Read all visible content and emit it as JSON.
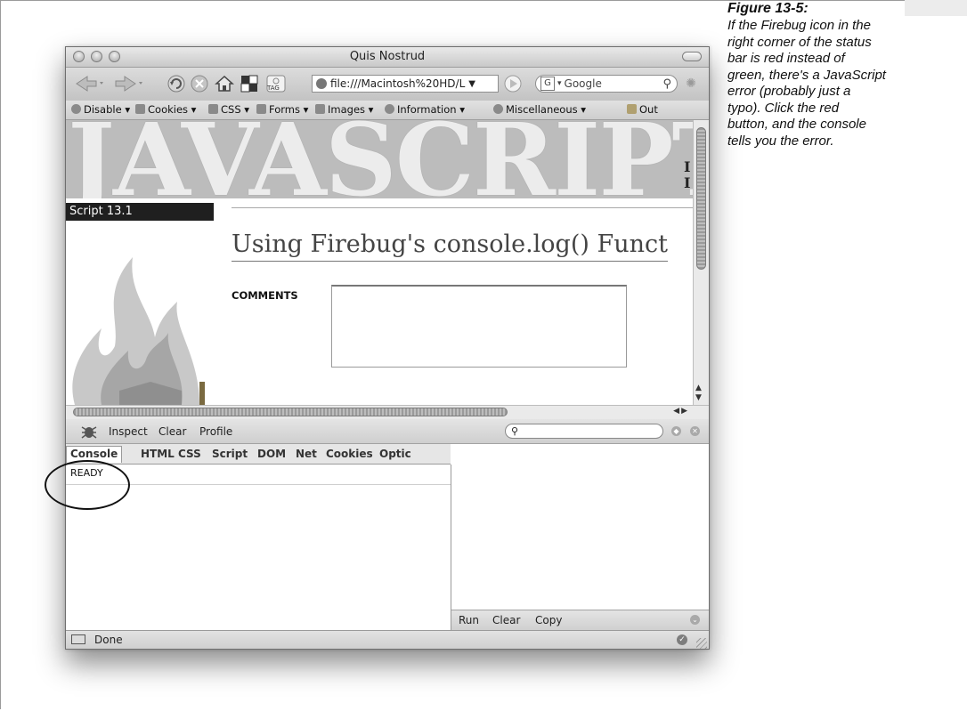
{
  "caption": {
    "figure_label": "Figure 13-5:",
    "lines": [
      "If the Firebug icon in the",
      "right corner of the status",
      "bar is red instead of",
      "green, there's a JavaScript",
      "error (probably just a",
      "typo). Click the red",
      "button, and the console",
      "tells you the error."
    ]
  },
  "window": {
    "title": "Quis Nostrud",
    "url": "file:///Macintosh%20HD/L",
    "search_placeholder": "Google",
    "tag_label": "TAG"
  },
  "dev_toolbar": {
    "items": [
      "Disable",
      "Cookies",
      "CSS",
      "Forms",
      "Images",
      "Information",
      "Miscellaneous",
      "Out"
    ]
  },
  "page": {
    "banner_text": "JAVASCRIPT",
    "banner_side": [
      "I",
      "I"
    ],
    "script_label": "Script 13.1",
    "heading": "Using Firebug's console.log() Funct",
    "comments_label": "COMMENTS"
  },
  "firebug": {
    "toolbar": [
      "Inspect",
      "Clear",
      "Profile"
    ],
    "tabs": [
      "Console",
      "HTML",
      "CSS",
      "Script",
      "DOM",
      "Net",
      "Cookies",
      "Optic"
    ],
    "active_tab": "Console",
    "console_text": "READY",
    "right_bar": [
      "Run",
      "Clear",
      "Copy"
    ]
  },
  "status": {
    "text": "Done"
  },
  "colors": {
    "banner_bg": "#bcbcbc",
    "script_label_bg": "#1f1f1f"
  }
}
